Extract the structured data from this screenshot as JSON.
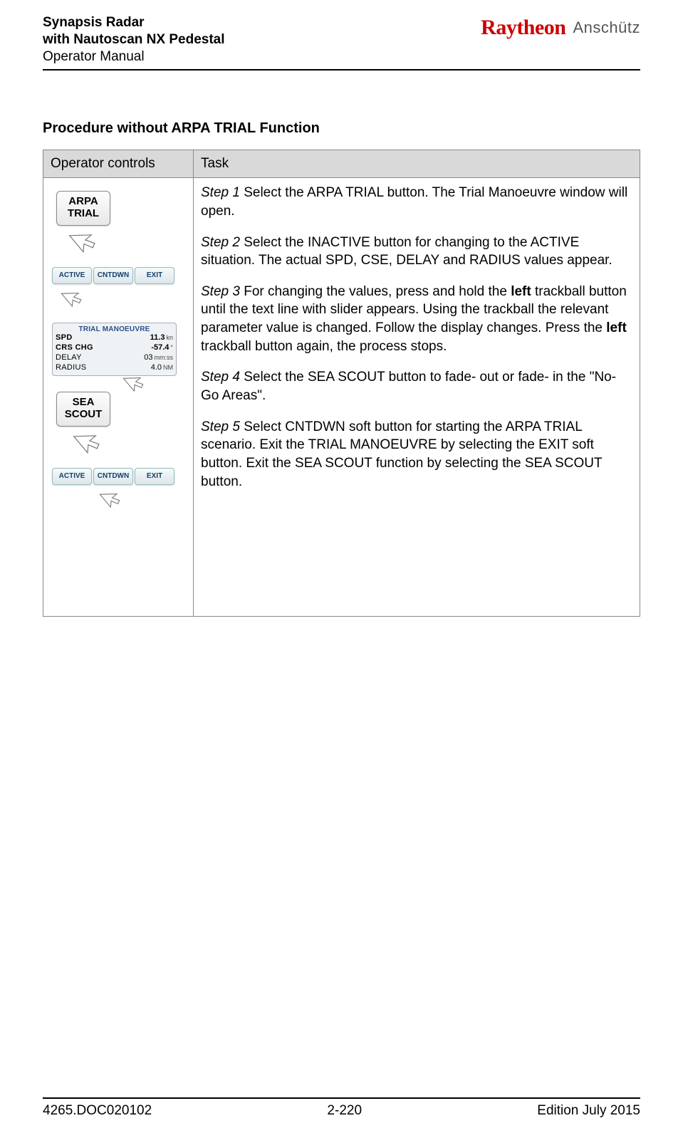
{
  "header": {
    "title_line1": "Synapsis Radar",
    "title_line2": "with Nautoscan NX Pedestal",
    "subtitle": "Operator Manual",
    "brand_main": "Raytheon",
    "brand_sub": "Anschütz"
  },
  "section_title": "Procedure without ARPA TRIAL Function",
  "table": {
    "col1_header": "Operator controls",
    "col2_header": "Task"
  },
  "steps": {
    "s1_label": "Step 1",
    "s1_text": " Select the ARPA TRIAL button. The Trial Manoeuvre window will open.",
    "s2_label": "Step 2",
    "s2_text": " Select the INACTIVE button for changing to the ACTIVE situation. The actual SPD, CSE, DELAY and RADIUS values appear.",
    "s3_label": "Step 3",
    "s3_text_a": " For changing the values, press and hold the ",
    "s3_bold_a": "left",
    "s3_text_b": " trackball button until the text line with slider appears. Using the trackball the relevant parameter value is changed. Follow the display changes. Press the ",
    "s3_bold_b": "left",
    "s3_text_c": " trackball button again, the process stops.",
    "s4_label": "Step 4",
    "s4_text": " Select the SEA SCOUT button to fade- out or fade- in the \"No- Go Areas\".",
    "s5_label": "Step 5",
    "s5_text": " Select CNTDWN soft button for starting the ARPA TRIAL scenario. Exit the TRIAL MANOEUVRE by selecting the EXIT soft button. Exit the SEA SCOUT function by selecting the SEA SCOUT button."
  },
  "ui": {
    "arpa_trial_btn_l1": "ARPA",
    "arpa_trial_btn_l2": "TRIAL",
    "sea_scout_btn_l1": "SEA",
    "sea_scout_btn_l2": "SCOUT",
    "row1_b1": "ACTIVE",
    "row1_b2": "CNTDWN",
    "row1_b3": "EXIT",
    "row2_b1": "ACTIVE",
    "row2_b2": "CNTDWN",
    "row2_b3": "EXIT",
    "trial_title": "TRIAL MANOEUVRE",
    "trial_r1_l": "SPD",
    "trial_r1_v": "11.3",
    "trial_r1_u": "kn",
    "trial_r2_l": "CRS CHG",
    "trial_r2_v": "-57.4",
    "trial_r2_u": "°",
    "trial_r3_l": "DELAY",
    "trial_r3_v": "03",
    "trial_r3_u": "mm:ss",
    "trial_r4_l": "RADIUS",
    "trial_r4_v": "4.0",
    "trial_r4_u": "NM"
  },
  "footer": {
    "left": "4265.DOC020102",
    "center": "2-220",
    "right": "Edition July 2015"
  }
}
